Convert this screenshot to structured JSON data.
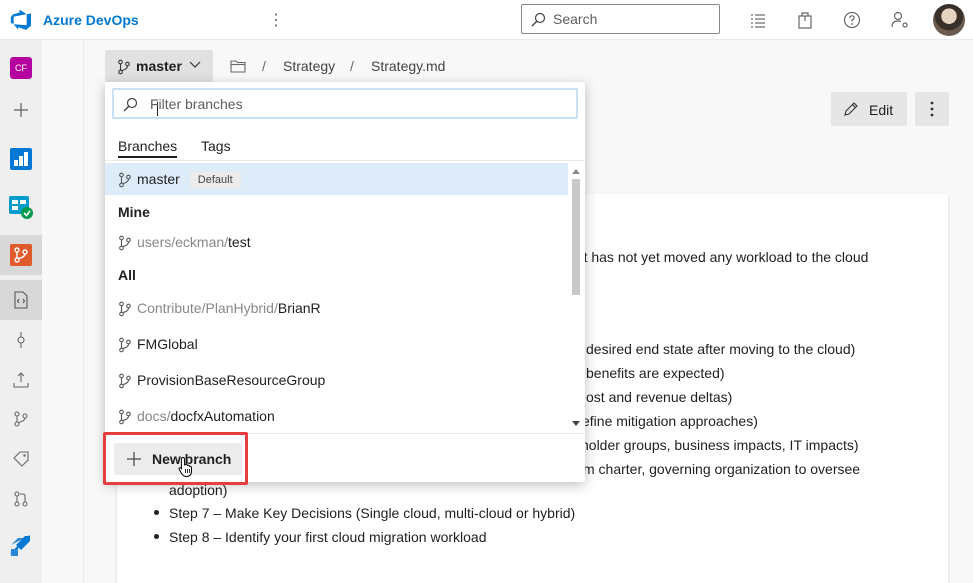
{
  "topbar": {
    "brand": "Azure DevOps",
    "search_placeholder": "Search"
  },
  "rail": {
    "project_initials": "CF",
    "project_color": "#b4009e"
  },
  "breadcrumb": {
    "branch": "master",
    "path": [
      "Strategy",
      "Strategy.md"
    ]
  },
  "toolbar": {
    "edit_label": "Edit"
  },
  "content": {
    "line_fragments": [
      "ent has not yet moved any workload to the cloud",
      "desired end state after moving to the cloud)",
      "benefits are expected)",
      "ost and revenue deltas)",
      "efine mitigation approaches)",
      "holder groups, business impacts, IT impacts)",
      "m charter, governing organization to oversee",
      "adoption)"
    ],
    "bullets": [
      "Step 7 – Make Key Decisions (Single cloud, multi-cloud or hybrid)",
      "Step 8 – Identify your first cloud migration workload"
    ]
  },
  "dropdown": {
    "filter_placeholder": "Filter branches",
    "tabs": [
      "Branches",
      "Tags"
    ],
    "active_tab": "Branches",
    "selected_branch": {
      "name": "master",
      "badge": "Default"
    },
    "groups": [
      {
        "label": "Mine",
        "branches": [
          {
            "prefix": "users/eckman/",
            "name": "test"
          }
        ]
      },
      {
        "label": "All",
        "branches": [
          {
            "prefix": "Contribute/PlanHybrid/",
            "name": "BrianR"
          },
          {
            "prefix": "",
            "name": "FMGlobal"
          },
          {
            "prefix": "",
            "name": "ProvisionBaseResourceGroup"
          },
          {
            "prefix": "docs/",
            "name": "docfxAutomation"
          }
        ]
      }
    ],
    "new_branch_label": "New branch"
  },
  "colors": {
    "brand": "#0078d4",
    "selection": "#deecf9",
    "highlight": "#e53e3e"
  }
}
